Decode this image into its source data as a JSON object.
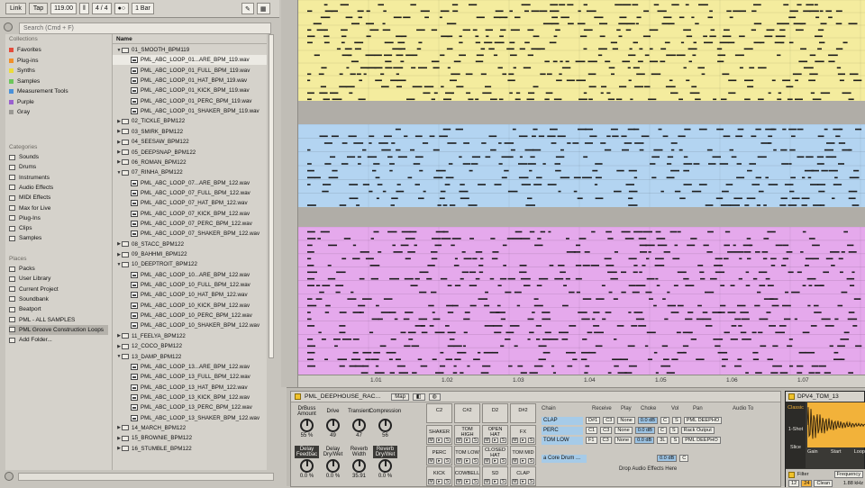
{
  "transport": {
    "link": "Link",
    "tap": "Tap",
    "tempo": "119.00",
    "signature_num": "4",
    "signature_sep": "/",
    "signature_den": "4",
    "metronome": "●○",
    "quantize": "1 Bar"
  },
  "browser": {
    "search_placeholder": "Search (Cmd + F)",
    "collections_title": "Collections",
    "collections": [
      {
        "label": "Favorites",
        "color": "#e44c3b"
      },
      {
        "label": "Plug-ins",
        "color": "#f0902a"
      },
      {
        "label": "Synths",
        "color": "#eddb3a"
      },
      {
        "label": "Samples",
        "color": "#6cc65a"
      },
      {
        "label": "Measurement Tools",
        "color": "#4a91d9"
      },
      {
        "label": "Purple",
        "color": "#9a60cf"
      },
      {
        "label": "Gray",
        "color": "#9a9893"
      }
    ],
    "categories_title": "Categories",
    "categories": [
      "Sounds",
      "Drums",
      "Instruments",
      "Audio Effects",
      "MIDI Effects",
      "Max for Live",
      "Plug-Ins",
      "Clips",
      "Samples"
    ],
    "places_title": "Places",
    "places": [
      "Packs",
      "User Library",
      "Current Project",
      "Soundbank",
      "Beatport",
      "PML - ALL SAMPLES",
      "PML Groove Construction Loops",
      "Add Folder..."
    ],
    "name_header": "Name",
    "rows": [
      {
        "t": "f",
        "o": true,
        "label": "01_SMOOTH_BPM119"
      },
      {
        "t": "w",
        "label": "PML_ABC_LOOP_01...ARE_BPM_119.wav",
        "sel": true
      },
      {
        "t": "w",
        "label": "PML_ABC_LOOP_01_FULL_BPM_119.wav"
      },
      {
        "t": "w",
        "label": "PML_ABC_LOOP_01_HAT_BPM_119.wav"
      },
      {
        "t": "w",
        "label": "PML_ABC_LOOP_01_KICK_BPM_119.wav"
      },
      {
        "t": "w",
        "label": "PML_ABC_LOOP_01_PERC_BPM_119.wav"
      },
      {
        "t": "w",
        "label": "PML_ABC_LOOP_01_SHAKER_BPM_119.wav"
      },
      {
        "t": "f",
        "label": "02_TICKLE_BPM122"
      },
      {
        "t": "f",
        "label": "03_SMIRK_BPM122"
      },
      {
        "t": "f",
        "label": "04_SEESAW_BPM122"
      },
      {
        "t": "f",
        "label": "05_DEEPSNAP_BPM122"
      },
      {
        "t": "f",
        "label": "06_ROMAN_BPM122"
      },
      {
        "t": "f",
        "o": true,
        "label": "07_RINHA_BPM122"
      },
      {
        "t": "w",
        "label": "PML_ABC_LOOP_07...ARE_BPM_122.wav"
      },
      {
        "t": "w",
        "label": "PML_ABC_LOOP_07_FULL_BPM_122.wav"
      },
      {
        "t": "w",
        "label": "PML_ABC_LOOP_07_HAT_BPM_122.wav"
      },
      {
        "t": "w",
        "label": "PML_ABC_LOOP_07_KICK_BPM_122.wav"
      },
      {
        "t": "w",
        "label": "PML_ABC_LOOP_07_PERC_BPM_122.wav"
      },
      {
        "t": "w",
        "label": "PML_ABC_LOOP_07_SHAKER_BPM_122.wav"
      },
      {
        "t": "f",
        "label": "08_STACC_BPM122"
      },
      {
        "t": "f",
        "label": "09_BAHHMI_BPM122"
      },
      {
        "t": "f",
        "o": true,
        "label": "10_DEEPTROIT_BPM122"
      },
      {
        "t": "w",
        "label": "PML_ABC_LOOP_10...ARE_BPM_122.wav"
      },
      {
        "t": "w",
        "label": "PML_ABC_LOOP_10_FULL_BPM_122.wav"
      },
      {
        "t": "w",
        "label": "PML_ABC_LOOP_10_HAT_BPM_122.wav"
      },
      {
        "t": "w",
        "label": "PML_ABC_LOOP_10_KICK_BPM_122.wav"
      },
      {
        "t": "w",
        "label": "PML_ABC_LOOP_10_PERC_BPM_122.wav"
      },
      {
        "t": "w",
        "label": "PML_ABC_LOOP_10_SHAKER_BPM_122.wav"
      },
      {
        "t": "f",
        "label": "11_FEELYA_BPM122"
      },
      {
        "t": "f",
        "label": "12_COCO_BPM122"
      },
      {
        "t": "f",
        "o": true,
        "label": "13_DAMP_BPM122"
      },
      {
        "t": "w",
        "label": "PML_ABC_LOOP_13...ARE_BPM_122.wav"
      },
      {
        "t": "w",
        "label": "PML_ABC_LOOP_13_FULL_BPM_122.wav"
      },
      {
        "t": "w",
        "label": "PML_ABC_LOOP_13_HAT_BPM_122.wav"
      },
      {
        "t": "w",
        "label": "PML_ABC_LOOP_13_KICK_BPM_122.wav"
      },
      {
        "t": "w",
        "label": "PML_ABC_LOOP_13_PERC_BPM_122.wav"
      },
      {
        "t": "w",
        "label": "PML_ABC_LOOP_13_SHAKER_BPM_122.wav"
      },
      {
        "t": "f",
        "label": "14_MARCH_BPM122"
      },
      {
        "t": "f",
        "label": "15_BROWNIE_BPM122"
      },
      {
        "t": "f",
        "label": "16_STUMBLE_BPM122"
      }
    ]
  },
  "arrangement": {
    "colors": {
      "yellow": "#f4ec9e",
      "blue": "#b3d4f1",
      "pink": "#e5a9ec",
      "gap": "#b0ada7"
    },
    "ruler": [
      "1.01",
      "1.02",
      "1.03",
      "1.04",
      "1.05",
      "1.06",
      "1.07"
    ]
  },
  "device": {
    "rack_name": "PML_DEEPHOUSE_RAC...",
    "map_button": "Map",
    "macros": [
      {
        "label": "DrBuss Amount",
        "value": "55 %"
      },
      {
        "label": "Drive",
        "value": "49"
      },
      {
        "label": "Transient",
        "value": "47"
      },
      {
        "label": "Compression",
        "value": "56"
      },
      {
        "label": "Delay Feedbac",
        "value": "0.0 %",
        "dark": true
      },
      {
        "label": "Delay Dry/Wet",
        "value": "0.0 %"
      },
      {
        "label": "Reverb Width",
        "value": "35.91"
      },
      {
        "label": "Reverb Dry/Wet",
        "value": "0.0 %",
        "dark": true
      }
    ],
    "pad_notes": [
      "C2",
      "C#2",
      "D2",
      "D#2"
    ],
    "pads": [
      [
        "SHAKER",
        "TOM HIGH",
        "OPEN HAT",
        "FX"
      ],
      [
        "PERC",
        "TOM LOW",
        "CLOSED HAT",
        "TOM MID"
      ],
      [
        "KICK",
        "COWBELL",
        "SD",
        "CLAP"
      ]
    ],
    "pad_m": "M",
    "pad_s": "S",
    "chain_headers": {
      "chain": "Chain",
      "receive": "Receive",
      "play": "Play",
      "choke": "Choke",
      "vol": "Vol",
      "pan": "Pan",
      "audio_to": "Audio To"
    },
    "chains": [
      {
        "name": "CLAP",
        "receive": "D#1",
        "play": "C3",
        "choke": "None",
        "vol": "0.0 dB",
        "pan": "C",
        "audio_to": "PML DEEPHO"
      },
      {
        "name": "PERC",
        "receive": "C1",
        "play": "C3",
        "choke": "None",
        "vol": "0.0 dB",
        "pan": "C",
        "audio_to": "Rack Output"
      },
      {
        "name": "TOM LOW",
        "receive": "F1",
        "play": "C3",
        "choke": "None",
        "vol": "0.0 dB",
        "pan": "3L",
        "audio_to": "PML DEEPHO"
      }
    ],
    "core_chain": "a Core Drum ...",
    "core_vol": "0.0 dB",
    "core_pan": "C",
    "drop_text": "Drop Audio Effects Here"
  },
  "simpler": {
    "name": "DPV4_TOM_13",
    "mode": "Classic",
    "one_shot": "1-Shot",
    "slice": "Slice",
    "gain": "Gain",
    "start": "Start",
    "loop": "Loop",
    "filter": "Filter",
    "frequency": "Frequency",
    "voices_a": "12",
    "voices_b": "24",
    "clean": "Clean",
    "freq_val": "1.88 kHz",
    "wave_color": "#f2b23a"
  }
}
